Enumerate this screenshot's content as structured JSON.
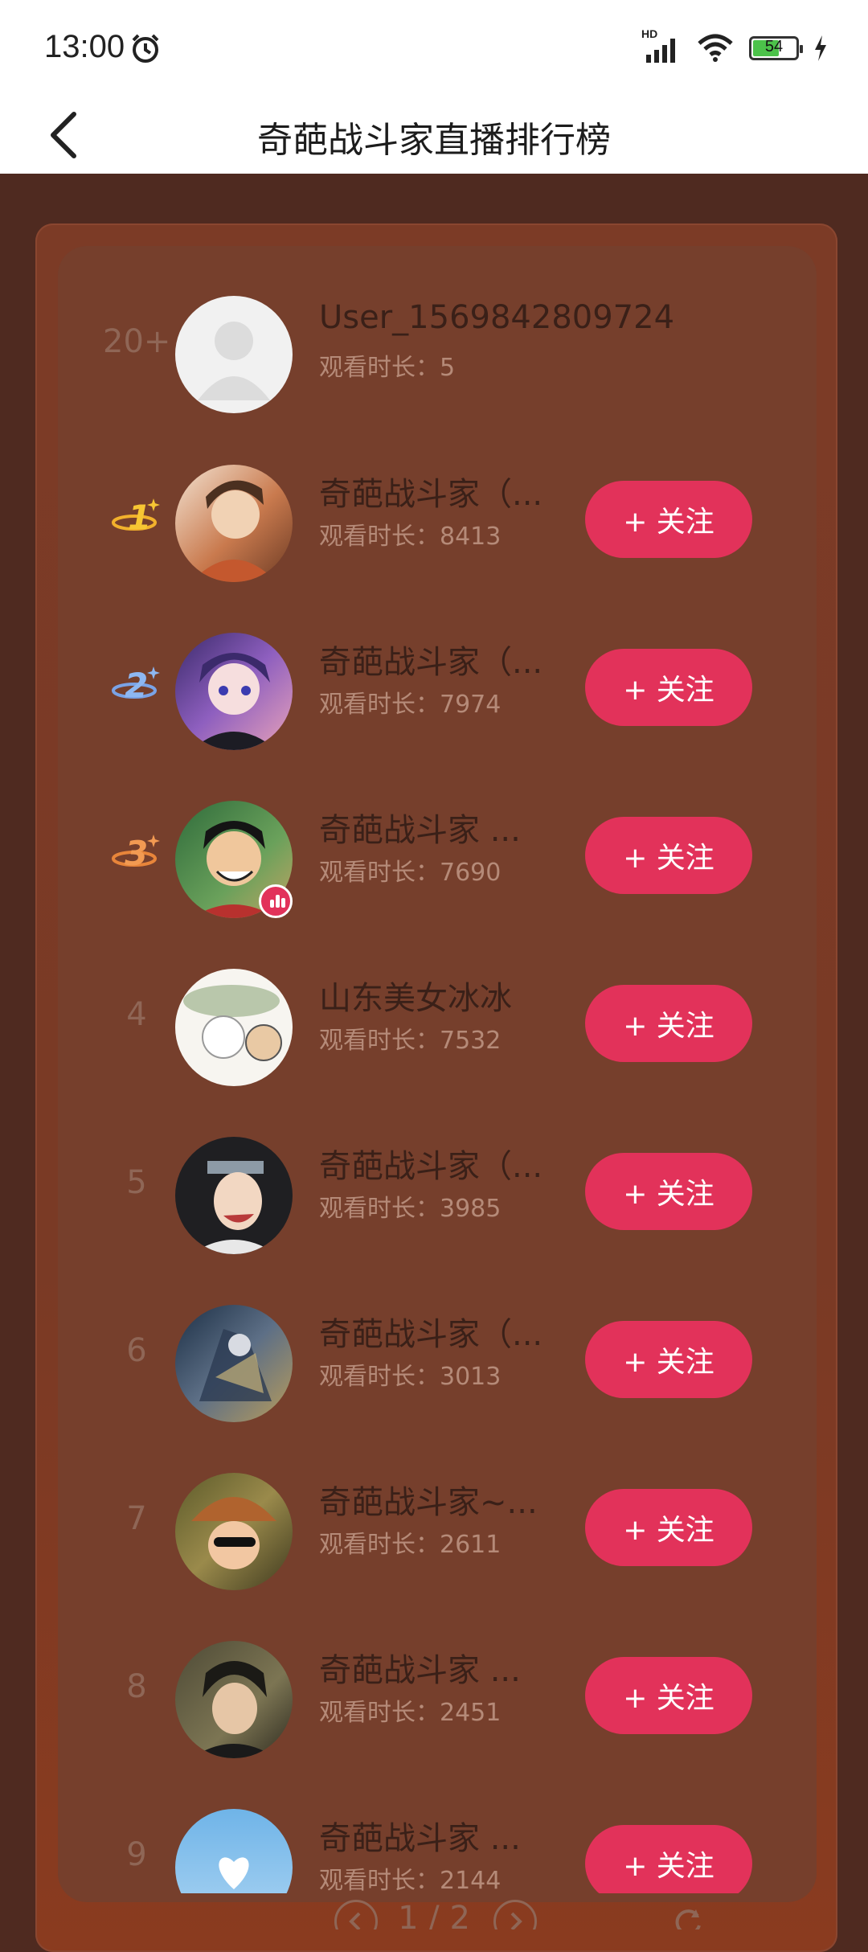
{
  "status_bar": {
    "time": "13:00",
    "network": "HD",
    "battery": "54"
  },
  "header": {
    "title": "奇葩战斗家直播排行榜"
  },
  "follow_label": "+ 关注",
  "my_rank": {
    "rank": "20+",
    "name": "User_1569842809724",
    "watch": "观看时长：5"
  },
  "ranking": [
    {
      "rank": "1",
      "name": "奇葩战斗家（...",
      "watch": "观看时长：8413"
    },
    {
      "rank": "2",
      "name": "奇葩战斗家（...",
      "watch": "观看时长：7974"
    },
    {
      "rank": "3",
      "name": "奇葩战斗家 ...",
      "watch": "观看时长：7690"
    },
    {
      "rank": "4",
      "name": "山东美女冰冰",
      "watch": "观看时长：7532"
    },
    {
      "rank": "5",
      "name": "奇葩战斗家（...",
      "watch": "观看时长：3985"
    },
    {
      "rank": "6",
      "name": "奇葩战斗家（...",
      "watch": "观看时长：3013"
    },
    {
      "rank": "7",
      "name": "奇葩战斗家~...",
      "watch": "观看时长：2611"
    },
    {
      "rank": "8",
      "name": "奇葩战斗家 ...",
      "watch": "观看时长：2451"
    },
    {
      "rank": "9",
      "name": "奇葩战斗家 ...",
      "watch": "观看时长：2144"
    }
  ],
  "pager": {
    "page_text": "1 / 2"
  }
}
